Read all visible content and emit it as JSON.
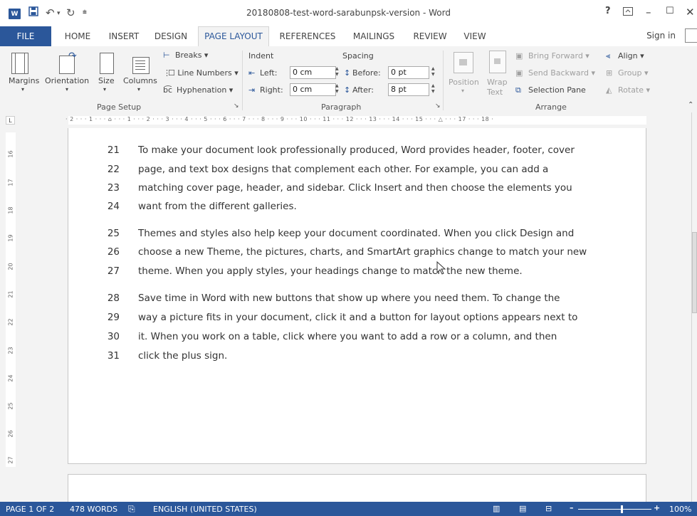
{
  "window": {
    "title": "20180808-test-word-sarabunpsk-version - Word",
    "help": "?",
    "signin": "Sign in"
  },
  "tabs": [
    "FILE",
    "HOME",
    "INSERT",
    "DESIGN",
    "PAGE LAYOUT",
    "REFERENCES",
    "MAILINGS",
    "REVIEW",
    "VIEW"
  ],
  "active_tab": "PAGE LAYOUT",
  "ribbon": {
    "page_setup": {
      "group_label": "Page Setup",
      "margins": "Margins",
      "orientation": "Orientation",
      "size": "Size",
      "columns": "Columns",
      "breaks": "Breaks",
      "line_numbers": "Line Numbers",
      "hyphenation": "Hyphenation"
    },
    "paragraph": {
      "group_label": "Paragraph",
      "indent": "Indent",
      "spacing": "Spacing",
      "left": "Left:",
      "right": "Right:",
      "before": "Before:",
      "after": "After:",
      "left_value": "0 cm",
      "right_value": "0 cm",
      "before_value": "0 pt",
      "after_value": "8 pt"
    },
    "arrange": {
      "group_label": "Arrange",
      "position": "Position",
      "wrap_text": "Wrap Text",
      "bring_forward": "Bring Forward",
      "send_backward": "Send Backward",
      "selection_pane": "Selection Pane",
      "align": "Align",
      "group": "Group",
      "rotate": "Rotate"
    }
  },
  "ruler": {
    "h_labels": "· 2 · · · 1 · · · ⌂ · · · 1 · · · 2 · · · 3 · · · 4 · · · 5 · · · 6 · · · 7 · · · 8 · · · 9 · · · 10 · · · 11 · · · 12 · · · 13 · · · 14 · · · 15 · · · △ · · · 17 · · · 18 ·",
    "v_labels": [
      "16",
      "17",
      "18",
      "19",
      "20",
      "21",
      "22",
      "23",
      "24",
      "25",
      "26",
      "27"
    ]
  },
  "document": {
    "lines": [
      {
        "n": "21",
        "t": "To make your document look professionally produced, Word provides header, footer, cover"
      },
      {
        "n": "22",
        "t": "page, and text box designs that complement each other. For example, you can add a"
      },
      {
        "n": "23",
        "t": "matching cover page, header, and sidebar. Click Insert and then choose the elements you"
      },
      {
        "n": "24",
        "t": "want from the different galleries."
      },
      {
        "n": "25",
        "t": "Themes and styles also help keep your document coordinated. When you click Design and"
      },
      {
        "n": "26",
        "t": "choose a new Theme, the pictures, charts, and SmartArt graphics change to match your new"
      },
      {
        "n": "27",
        "t": "theme. When you apply styles, your headings change to match the new theme."
      },
      {
        "n": "28",
        "t": "Save time in Word with new buttons that show up where you need them. To change the"
      },
      {
        "n": "29",
        "t": "way a picture fits in your document, click it and a button for layout options appears next to"
      },
      {
        "n": "30",
        "t": "it. When you work on a table, click where you want to add a row or a column, and then"
      },
      {
        "n": "31",
        "t": "click the plus sign."
      }
    ]
  },
  "status": {
    "page": "PAGE 1 OF 2",
    "words": "478 WORDS",
    "language": "ENGLISH (UNITED STATES)",
    "zoom": "100%"
  }
}
